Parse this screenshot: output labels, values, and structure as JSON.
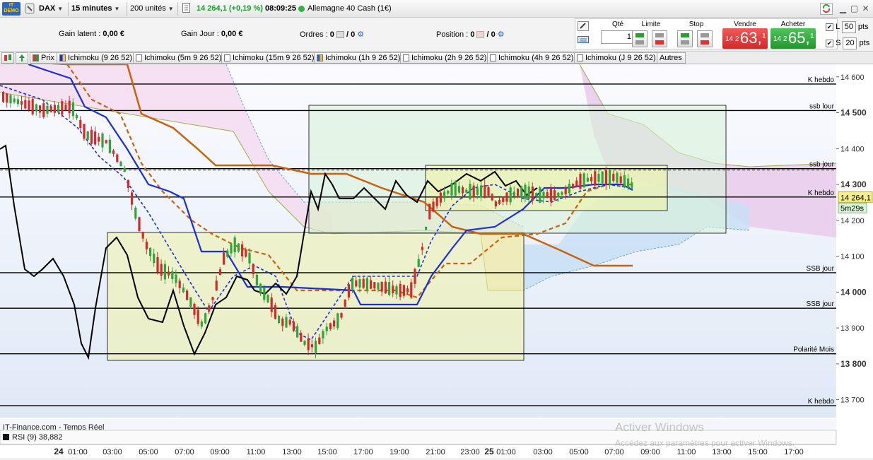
{
  "toolbar": {
    "demo_label": "DEMO",
    "instrument": "DAX",
    "timeframe": "15 minutes",
    "units": "200 unités",
    "last_price": "14 264,1",
    "change": "(+0,19 %)",
    "time": "08:09:25",
    "market_name": "Allemagne 40 Cash (1€)"
  },
  "infobar": {
    "gain_latent_label": "Gain latent :",
    "gain_latent_value": "0,00 €",
    "gain_jour_label": "Gain Jour :",
    "gain_jour_value": "0,00 €",
    "ordres_label": "Ordres :",
    "ordres_a": "0",
    "ordres_b": "/ 0",
    "position_label": "Position :",
    "position_a": "0",
    "position_b": "/ 0"
  },
  "order_panel": {
    "qte_label": "Qté",
    "qte_value": "1",
    "limite_label": "Limite",
    "stop_label": "Stop",
    "vendre_label": "Vendre",
    "acheter_label": "Acheter",
    "sell_small": "14 2",
    "sell_big": "63,",
    "sell_end": "1",
    "buy_small": "14 2",
    "buy_big": "65,",
    "buy_end": "1",
    "l_label": "L",
    "l_value": "50",
    "s_label": "S",
    "s_value": "20",
    "pts_label": "pts"
  },
  "tabs": [
    {
      "label": "Prix"
    },
    {
      "label": "Ichimoku (9 26 52)"
    },
    {
      "label": "Ichimoku (5m 9 26 52)"
    },
    {
      "label": "Ichimoku (15m 9 26 52)"
    },
    {
      "label": "Ichimoku (1h 9 26 52)"
    },
    {
      "label": "Ichimoku (2h 9 26 52)"
    },
    {
      "label": "Ichimoku (4h 9 26 52)"
    },
    {
      "label": "Ichimoku (J 9 26 52)"
    },
    {
      "label": "Autres"
    }
  ],
  "chart_data": {
    "type": "candlestick",
    "instrument": "DAX",
    "timeframe": "15 minutes",
    "ylim": [
      13650,
      14635
    ],
    "y_ticks": [
      13700,
      13800,
      13900,
      14000,
      14100,
      14200,
      14300,
      14400,
      14500,
      14600
    ],
    "y_tick_labels": [
      "13 700",
      "13 800",
      "13 900",
      "14 000",
      "14 100",
      "14 200",
      "14 300",
      "14 400",
      "14 500",
      "14 600"
    ],
    "bold_y_ticks": [
      13800,
      14000,
      14300,
      14500
    ],
    "x_tick_labels": [
      "24",
      "01:00",
      "03:00",
      "05:00",
      "07:00",
      "09:00",
      "11:00",
      "13:00",
      "15:00",
      "17:00",
      "19:00",
      "21:00",
      "23:00",
      "25",
      "01:00",
      "03:00",
      "05:00",
      "07:00",
      "09:00",
      "11:00",
      "13:00",
      "15:00",
      "17:00"
    ],
    "current_price": "14 264,1",
    "countdown": "5m29s",
    "source_label": "IT-Finance.com - Temps Réel",
    "rsi_label": "RSI (9) 38,882",
    "levels": [
      {
        "label": "K hebdo",
        "price": 14580
      },
      {
        "label": "ssb lour",
        "price": 14506
      },
      {
        "label": "ssb jour",
        "price": 14344
      },
      {
        "label": "K hebdo",
        "price": 14265
      },
      {
        "label": "SSB jour",
        "price": 14054
      },
      {
        "label": "SSB jour",
        "price": 13955
      },
      {
        "label": "Polarité Mois",
        "price": 13828
      },
      {
        "label": "K hebdo",
        "price": 13683
      }
    ],
    "watermark_title": "Activer Windows",
    "watermark_sub": "Accédez aux paramètres pour activer Windows.",
    "colors": {
      "up": "#31a53b",
      "down": "#d22b2b",
      "kijun": "#c9620d",
      "tenkan": "#1b2fd6",
      "chikou": "#000000",
      "cloud_bull": "#d6e6f6",
      "cloud_bear": "#f1d6ee"
    }
  }
}
